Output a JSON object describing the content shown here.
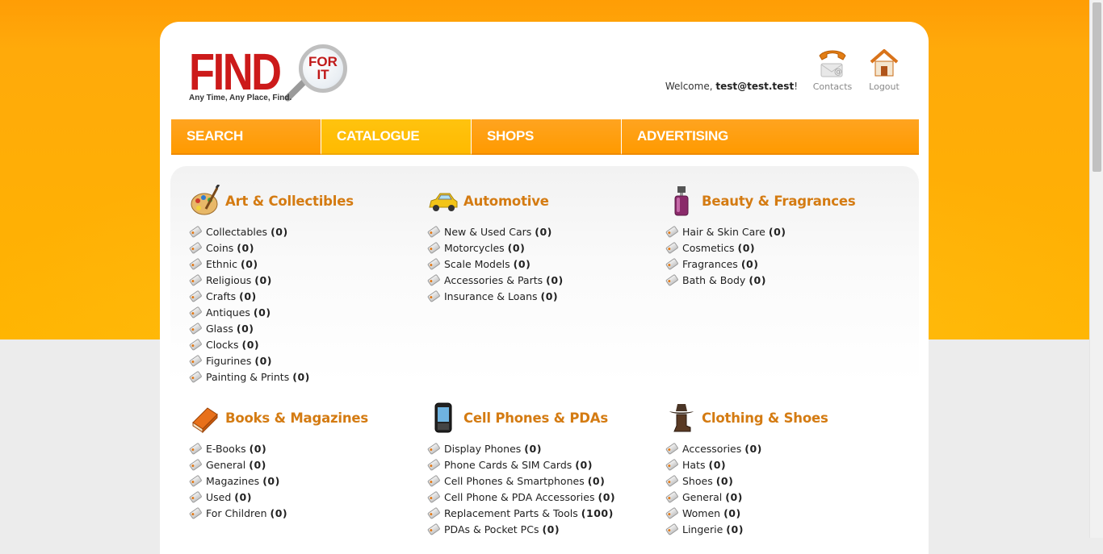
{
  "header": {
    "logo_text": "FIND",
    "logo_lens_text": [
      "FOR",
      "IT"
    ],
    "tagline": "Any Time, Any Place, Find.",
    "welcome_prefix": "Welcome,",
    "user": "test@test.test",
    "welcome_suffix": "!",
    "contacts_label": "Contacts",
    "logout_label": "Logout"
  },
  "nav": {
    "tabs": [
      {
        "label": "SEARCH",
        "active": false
      },
      {
        "label": "CATALOGUE",
        "active": true
      },
      {
        "label": "SHOPS",
        "active": false
      },
      {
        "label": "ADVERTISING",
        "active": false
      }
    ]
  },
  "categories": [
    {
      "title": "Art & Collectibles",
      "icon": "palette-icon",
      "items": [
        {
          "label": "Collectables",
          "count": "(0)"
        },
        {
          "label": "Coins",
          "count": "(0)"
        },
        {
          "label": "Ethnic",
          "count": "(0)"
        },
        {
          "label": "Religious",
          "count": "(0)"
        },
        {
          "label": "Crafts",
          "count": "(0)"
        },
        {
          "label": "Antiques",
          "count": "(0)"
        },
        {
          "label": "Glass",
          "count": "(0)"
        },
        {
          "label": "Clocks",
          "count": "(0)"
        },
        {
          "label": "Figurines",
          "count": "(0)"
        },
        {
          "label": "Painting & Prints",
          "count": "(0)"
        }
      ]
    },
    {
      "title": "Automotive",
      "icon": "car-icon",
      "items": [
        {
          "label": "New & Used Cars",
          "count": "(0)"
        },
        {
          "label": "Motorcycles",
          "count": "(0)"
        },
        {
          "label": "Scale Models",
          "count": "(0)"
        },
        {
          "label": "Accessories & Parts",
          "count": "(0)"
        },
        {
          "label": "Insurance & Loans",
          "count": "(0)"
        }
      ]
    },
    {
      "title": "Beauty & Fragrances",
      "icon": "perfume-bottle-icon",
      "items": [
        {
          "label": "Hair & Skin Care",
          "count": "(0)"
        },
        {
          "label": "Cosmetics",
          "count": "(0)"
        },
        {
          "label": "Fragrances",
          "count": "(0)"
        },
        {
          "label": "Bath & Body",
          "count": "(0)"
        }
      ]
    },
    {
      "title": "Books & Magazines",
      "icon": "book-icon",
      "items": [
        {
          "label": "E-Books",
          "count": "(0)"
        },
        {
          "label": "General",
          "count": "(0)"
        },
        {
          "label": "Magazines",
          "count": "(0)"
        },
        {
          "label": "Used",
          "count": "(0)"
        },
        {
          "label": "For Children",
          "count": "(0)"
        }
      ]
    },
    {
      "title": "Cell Phones & PDAs",
      "icon": "cell-phone-icon",
      "items": [
        {
          "label": "Display Phones",
          "count": "(0)"
        },
        {
          "label": "Phone Cards & SIM Cards",
          "count": "(0)"
        },
        {
          "label": "Cell Phones & Smartphones",
          "count": "(0)"
        },
        {
          "label": "Cell Phone & PDA Accessories",
          "count": "(0)"
        },
        {
          "label": "Replacement Parts & Tools",
          "count": "(100)"
        },
        {
          "label": "PDAs & Pocket PCs",
          "count": "(0)"
        }
      ]
    },
    {
      "title": "Clothing & Shoes",
      "icon": "cowboy-hat-icon",
      "items": [
        {
          "label": "Accessories",
          "count": "(0)"
        },
        {
          "label": "Hats",
          "count": "(0)"
        },
        {
          "label": "Shoes",
          "count": "(0)"
        },
        {
          "label": "General",
          "count": "(0)"
        },
        {
          "label": "Women",
          "count": "(0)"
        },
        {
          "label": "Lingerie",
          "count": "(0)"
        }
      ]
    }
  ]
}
